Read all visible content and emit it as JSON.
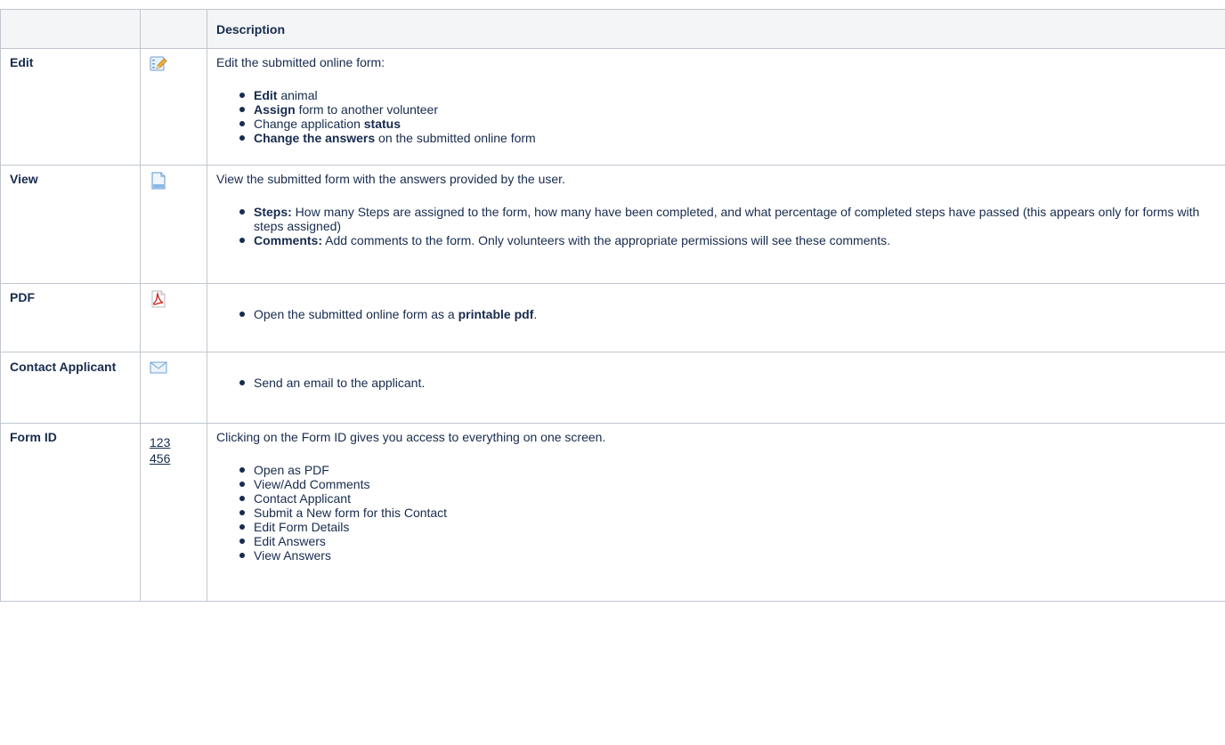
{
  "header": {
    "col_name": "",
    "col_icon": "",
    "col_description": "Description"
  },
  "rows": [
    {
      "name": "Edit",
      "icon": "edit-form-icon",
      "lead": "Edit the submitted online form:",
      "items": [
        {
          "bold": "Edit",
          "rest": " animal"
        },
        {
          "bold": "Assign",
          "rest": " form to another volunteer"
        },
        {
          "pre": "Change application ",
          "bold": "status",
          "rest": ""
        },
        {
          "bold": "Change the answers",
          "rest": " on the submitted online form"
        }
      ]
    },
    {
      "name": "View",
      "icon": "document-icon",
      "lead": "View the submitted form with the answers provided by the user.",
      "items": [
        {
          "bold": "Steps:",
          "rest": " How many Steps are assigned to the form, how many have been completed, and what percentage of completed steps have passed (this appears only for forms with steps assigned)"
        },
        {
          "bold": "Comments:",
          "rest": "  Add comments to the form. Only volunteers with the appropriate permissions will see these comments."
        }
      ]
    },
    {
      "name": "PDF",
      "icon": "pdf-icon",
      "lead": "",
      "items": [
        {
          "pre": "Open the submitted online form as a ",
          "bold": "printable pdf",
          "rest": "."
        }
      ]
    },
    {
      "name": "Contact Applicant",
      "icon": "envelope-icon",
      "lead": "",
      "items": [
        {
          "pre": "Send an email to the applicant.",
          "bold": "",
          "rest": ""
        }
      ]
    },
    {
      "name": "Form ID",
      "icon_links": [
        "123",
        "456"
      ],
      "lead": "Clicking on the Form ID gives you access to everything on one screen.",
      "items": [
        {
          "pre": "Open as PDF"
        },
        {
          "pre": "View/Add Comments"
        },
        {
          "pre": "Contact Applicant"
        },
        {
          "pre": "Submit a New form for this Contact"
        },
        {
          "pre": "Edit Form Details"
        },
        {
          "pre": "Edit Answers"
        },
        {
          "pre": "View Answers"
        }
      ]
    }
  ]
}
